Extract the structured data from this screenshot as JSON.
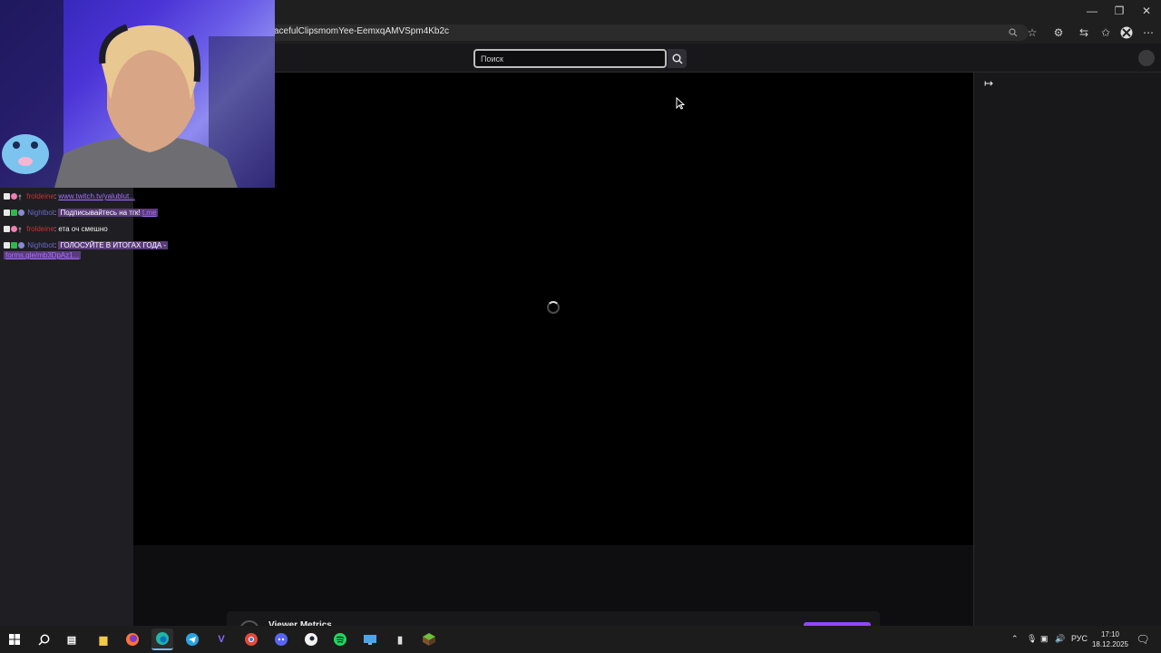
{
  "browser": {
    "url": "acefulClipsmomYee-EemxqAMVSpm4Kb2c"
  },
  "twitch": {
    "search_placeholder": "Поиск"
  },
  "chat": {
    "messages": [
      {
        "user": "froldeine",
        "sep": ": ",
        "text": "www.twitch.tv/yalublut...",
        "is_link": true
      },
      {
        "user": "Nightbot",
        "sep": ": ",
        "text": "Подписывайтесь на тгк!",
        "link": "t.me",
        "highlight": true
      },
      {
        "user": "froldeine",
        "sep": ": ",
        "text": "ета оч смешно"
      },
      {
        "user": "Nightbot",
        "sep": ": ",
        "text": "ГОЛОСУЙТЕ В ИТОГАХ ГОДА -",
        "link": "forms.gle/mb3DpAz1...",
        "highlight": true
      }
    ]
  },
  "below_player": {
    "metrics_title": "Viewer Metrics"
  },
  "taskbar": {
    "language": "РУС",
    "time": "17:10",
    "date": "18.12.2025",
    "notifications": "2",
    "apps": [
      "start-icon",
      "search-icon",
      "task-view-icon",
      "file-explorer-icon",
      "firefox-icon",
      "edge-icon",
      "telegram-icon",
      "vivaldi-icon",
      "chrome-icon",
      "discord-icon",
      "steam-icon",
      "spotify-icon",
      "monitor-app-icon",
      "notepad-icon",
      "minecraft-icon"
    ]
  },
  "colors": {
    "accent": "#9147ff",
    "link": "#a970ff"
  }
}
